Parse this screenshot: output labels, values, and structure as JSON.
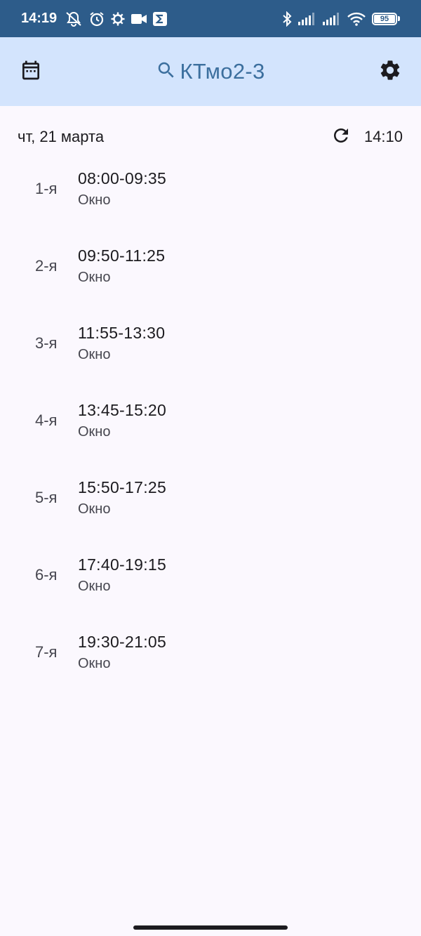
{
  "status_bar": {
    "time": "14:19",
    "battery": "95",
    "icons": [
      "mute-icon",
      "alarm-icon",
      "settings-sync-icon",
      "video-icon",
      "sigma-icon",
      "bluetooth-icon",
      "signal-icon",
      "signal-icon",
      "wifi-icon",
      "battery-icon"
    ]
  },
  "app_bar": {
    "title": "КТмо2-3",
    "left_icon": "calendar-icon",
    "search_icon": "search-icon",
    "right_icon": "gear-icon",
    "background": "#d3e4fd",
    "title_color": "#3c6f9e"
  },
  "date_row": {
    "date": "чт, 21 марта",
    "refresh_icon": "refresh-icon",
    "updated_time": "14:10"
  },
  "lessons": [
    {
      "num": "1-я",
      "time": "08:00-09:35",
      "subject": "Окно"
    },
    {
      "num": "2-я",
      "time": "09:50-11:25",
      "subject": "Окно"
    },
    {
      "num": "3-я",
      "time": "11:55-13:30",
      "subject": "Окно"
    },
    {
      "num": "4-я",
      "time": "13:45-15:20",
      "subject": "Окно"
    },
    {
      "num": "5-я",
      "time": "15:50-17:25",
      "subject": "Окно"
    },
    {
      "num": "6-я",
      "time": "17:40-19:15",
      "subject": "Окно"
    },
    {
      "num": "7-я",
      "time": "19:30-21:05",
      "subject": "Окно"
    }
  ],
  "colors": {
    "status_bar": "#2d5c8a",
    "page_background": "#fbf8fe"
  }
}
